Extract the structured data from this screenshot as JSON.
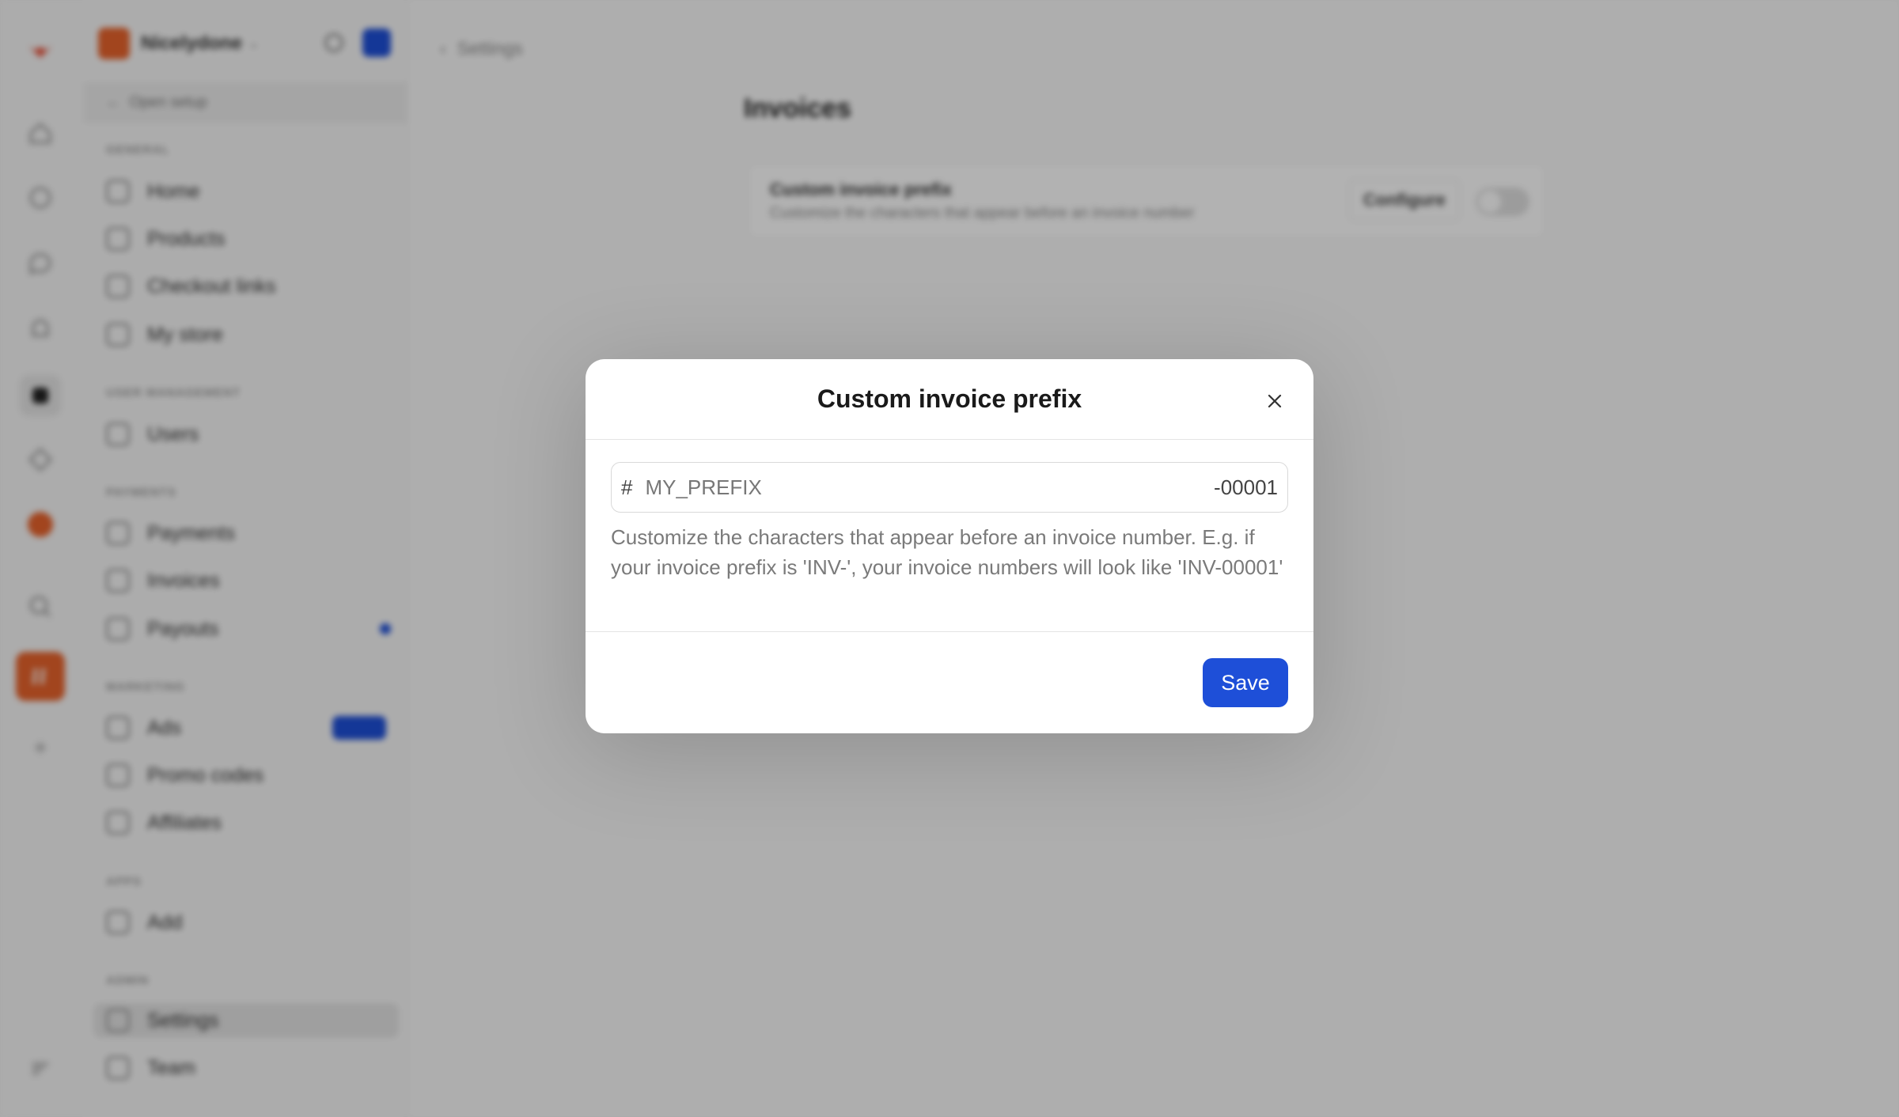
{
  "workspace": {
    "name": "Nicelydone"
  },
  "sidebar": {
    "setup_label": "Open setup",
    "sections": [
      {
        "title": "GENERAL",
        "items": [
          "Home",
          "Products",
          "Checkout links",
          "My store"
        ]
      },
      {
        "title": "USER MANAGEMENT",
        "items": [
          "Users"
        ]
      },
      {
        "title": "PAYMENTS",
        "items": [
          "Payments",
          "Invoices",
          "Payouts"
        ]
      },
      {
        "title": "MARKETING",
        "items": [
          "Ads",
          "Promo codes",
          "Affiliates"
        ]
      },
      {
        "title": "APPS",
        "items": [
          "Add"
        ]
      },
      {
        "title": "ADMIN",
        "items": [
          "Settings",
          "Team"
        ]
      }
    ]
  },
  "main": {
    "breadcrumb": "Settings",
    "page_title": "Invoices",
    "card": {
      "title": "Custom invoice prefix",
      "description": "Customize the characters that appear before an invoice number",
      "button_label": "Configure",
      "toggle_on": false
    }
  },
  "modal": {
    "title": "Custom invoice prefix",
    "prefix_symbol": "#",
    "input_placeholder": "MY_PREFIX",
    "input_value": "",
    "suffix": "-00001",
    "help_text": "Customize the characters that appear before an invoice number. E.g. if your invoice prefix is 'INV-', your invoice numbers will look like 'INV-00001'",
    "save_label": "Save"
  },
  "colors": {
    "accent": "#1e4fd8",
    "brand": "#e8632c"
  }
}
